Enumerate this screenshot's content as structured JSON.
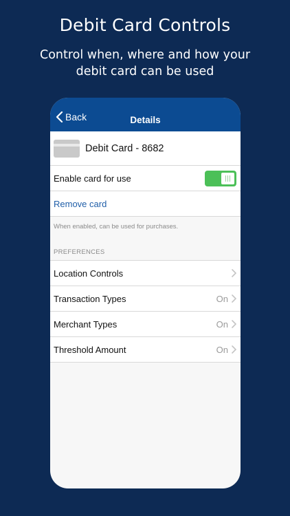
{
  "promo": {
    "title": "Debit Card Controls",
    "subtitle": "Control when, where and how your debit card can be used"
  },
  "navbar": {
    "back_label": "Back",
    "title": "Details"
  },
  "card": {
    "name": "Debit Card - 8682",
    "icon": "card-icon"
  },
  "enable": {
    "label": "Enable card for use",
    "enabled": true
  },
  "remove": {
    "label": "Remove card"
  },
  "note": "When enabled, can be used for purchases.",
  "preferences": {
    "header": "PREFERENCES",
    "items": [
      {
        "label": "Location Controls",
        "value": ""
      },
      {
        "label": "Transaction Types",
        "value": "On"
      },
      {
        "label": "Merchant Types",
        "value": "On"
      },
      {
        "label": "Threshold Amount",
        "value": "On"
      }
    ]
  },
  "colors": {
    "background": "#0d2a54",
    "navbar": "#0c4b92",
    "toggle_on": "#4cc058",
    "link": "#1f5ea8"
  }
}
